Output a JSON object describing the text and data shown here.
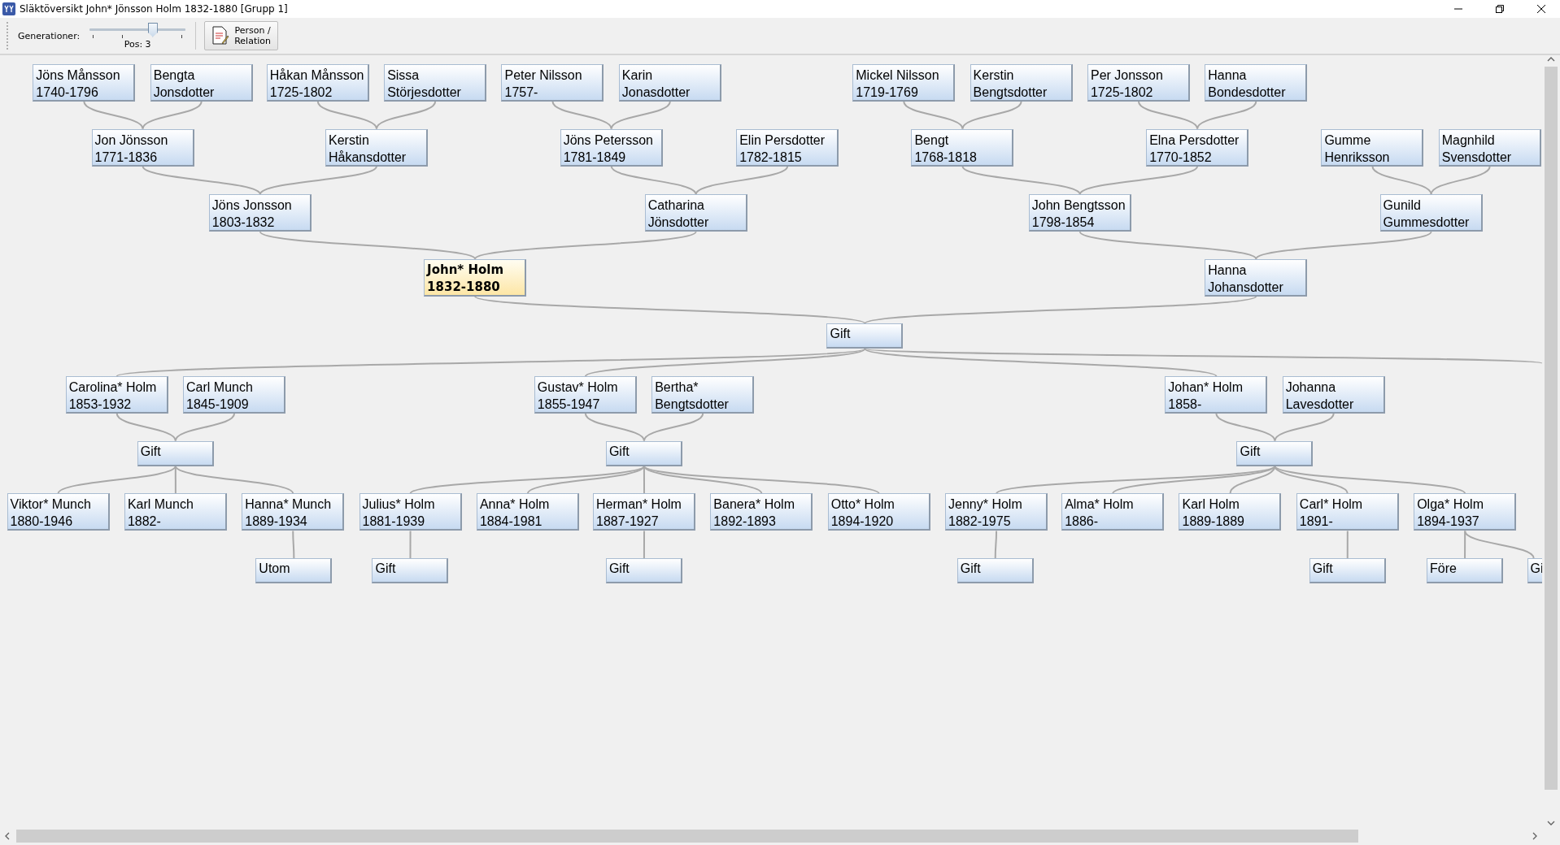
{
  "window": {
    "title": "Släktöversikt John* Jönsson Holm 1832-1880 [Grupp 1]"
  },
  "toolbar": {
    "slider": {
      "label": "Generationer:",
      "level": 0.65,
      "reading": "Pos: 3"
    },
    "button": {
      "label_1": "Person /",
      "label_2": "Relation"
    }
  },
  "tree": {
    "nodes": [
      {
        "kind": "person",
        "lines": [
          "Jöns Månsson",
          "1740-1796"
        ],
        "selected": false
      },
      {
        "kind": "person",
        "lines": [
          "Bengta",
          "Jonsdotter"
        ],
        "selected": false
      },
      {
        "kind": "person",
        "lines": [
          "Håkan Månsson",
          "1725-1802"
        ],
        "selected": false
      },
      {
        "kind": "person",
        "lines": [
          "Sissa",
          "Störjesdotter"
        ],
        "selected": false
      },
      {
        "kind": "person",
        "lines": [
          "Peter Nilsson",
          "1757-"
        ],
        "selected": false
      },
      {
        "kind": "person",
        "lines": [
          "Karin",
          "Jonasdotter"
        ],
        "selected": false
      },
      {
        "kind": "person",
        "lines": [
          "Mickel Nilsson",
          "1719-1769"
        ],
        "selected": false
      },
      {
        "kind": "person",
        "lines": [
          "Kerstin",
          "Bengtsdotter"
        ],
        "selected": false
      },
      {
        "kind": "person",
        "lines": [
          "Per Jonsson",
          "1725-1802"
        ],
        "selected": false
      },
      {
        "kind": "person",
        "lines": [
          "Hanna",
          "Bondesdotter"
        ],
        "selected": false
      },
      {
        "kind": "person",
        "lines": [
          "Jon Jönsson",
          "1771-1836"
        ],
        "selected": false
      },
      {
        "kind": "person",
        "lines": [
          "Kerstin",
          "Håkansdotter"
        ],
        "selected": false
      },
      {
        "kind": "person",
        "lines": [
          "Jöns Petersson",
          "1781-1849"
        ],
        "selected": false
      },
      {
        "kind": "person",
        "lines": [
          "Elin Persdotter",
          "1782-1815"
        ],
        "selected": false
      },
      {
        "kind": "person",
        "lines": [
          "Bengt",
          "1768-1818"
        ],
        "selected": false
      },
      {
        "kind": "person",
        "lines": [
          "Elna Persdotter",
          "1770-1852"
        ],
        "selected": false
      },
      {
        "kind": "person",
        "lines": [
          "Gumme",
          "Henriksson"
        ],
        "selected": false
      },
      {
        "kind": "person",
        "lines": [
          "Magnhild",
          "Svensdotter"
        ],
        "selected": false
      },
      {
        "kind": "person",
        "lines": [
          "Jöns Jonsson",
          "1803-1832"
        ],
        "selected": false
      },
      {
        "kind": "person",
        "lines": [
          "Catharina",
          "Jönsdotter"
        ],
        "selected": false
      },
      {
        "kind": "person",
        "lines": [
          "John Bengtsson",
          "1798-1854"
        ],
        "selected": false
      },
      {
        "kind": "person",
        "lines": [
          "Gunild",
          "Gummesdotter"
        ],
        "selected": false
      },
      {
        "kind": "person",
        "lines": [
          "John* Holm",
          "1832-1880"
        ],
        "selected": true
      },
      {
        "kind": "person",
        "lines": [
          "Hanna",
          "Johansdotter"
        ],
        "selected": false
      },
      {
        "kind": "event",
        "lines": [
          "Gift"
        ]
      },
      {
        "kind": "person",
        "lines": [
          "Carolina* Holm",
          "1853-1932"
        ],
        "selected": false
      },
      {
        "kind": "person",
        "lines": [
          "Carl Munch",
          "1845-1909"
        ],
        "selected": false
      },
      {
        "kind": "person",
        "lines": [
          "Gustav* Holm",
          "1855-1947"
        ],
        "selected": false
      },
      {
        "kind": "person",
        "lines": [
          "Bertha*",
          "Bengtsdotter"
        ],
        "selected": false
      },
      {
        "kind": "person",
        "lines": [
          "Johan* Holm",
          "1858-"
        ],
        "selected": false
      },
      {
        "kind": "person",
        "lines": [
          "Johanna",
          "Lavesdotter"
        ],
        "selected": false
      },
      {
        "kind": "event",
        "lines": [
          "Gift"
        ]
      },
      {
        "kind": "event",
        "lines": [
          "Gift"
        ]
      },
      {
        "kind": "event",
        "lines": [
          "Gift"
        ]
      },
      {
        "kind": "person",
        "lines": [
          "Viktor* Munch",
          "1880-1946"
        ],
        "selected": false
      },
      {
        "kind": "person",
        "lines": [
          "Karl Munch",
          "1882-"
        ],
        "selected": false
      },
      {
        "kind": "person",
        "lines": [
          "Hanna* Munch",
          "1889-1934"
        ],
        "selected": false
      },
      {
        "kind": "person",
        "lines": [
          "Julius* Holm",
          "1881-1939"
        ],
        "selected": false
      },
      {
        "kind": "person",
        "lines": [
          "Anna* Holm",
          "1884-1981"
        ],
        "selected": false
      },
      {
        "kind": "person",
        "lines": [
          "Herman* Holm",
          "1887-1927"
        ],
        "selected": false
      },
      {
        "kind": "person",
        "lines": [
          "Banera* Holm",
          "1892-1893"
        ],
        "selected": false
      },
      {
        "kind": "person",
        "lines": [
          "Otto* Holm",
          "1894-1920"
        ],
        "selected": false
      },
      {
        "kind": "person",
        "lines": [
          "Jenny* Holm",
          "1882-1975"
        ],
        "selected": false
      },
      {
        "kind": "person",
        "lines": [
          "Alma* Holm",
          "1886-"
        ],
        "selected": false
      },
      {
        "kind": "person",
        "lines": [
          "Karl Holm",
          "1889-1889"
        ],
        "selected": false
      },
      {
        "kind": "person",
        "lines": [
          "Carl* Holm",
          "1891-"
        ],
        "selected": false
      },
      {
        "kind": "person",
        "lines": [
          "Olga* Holm",
          "1894-1937"
        ],
        "selected": false
      },
      {
        "kind": "event",
        "lines": [
          "Utom"
        ]
      },
      {
        "kind": "event",
        "lines": [
          "Gift"
        ]
      },
      {
        "kind": "event",
        "lines": [
          "Gift"
        ]
      },
      {
        "kind": "event",
        "lines": [
          "Gift"
        ]
      },
      {
        "kind": "event",
        "lines": [
          "Gift"
        ]
      },
      {
        "kind": "event",
        "lines": [
          "Före"
        ]
      },
      {
        "kind": "event",
        "lines": [
          "Gi"
        ]
      }
    ]
  }
}
